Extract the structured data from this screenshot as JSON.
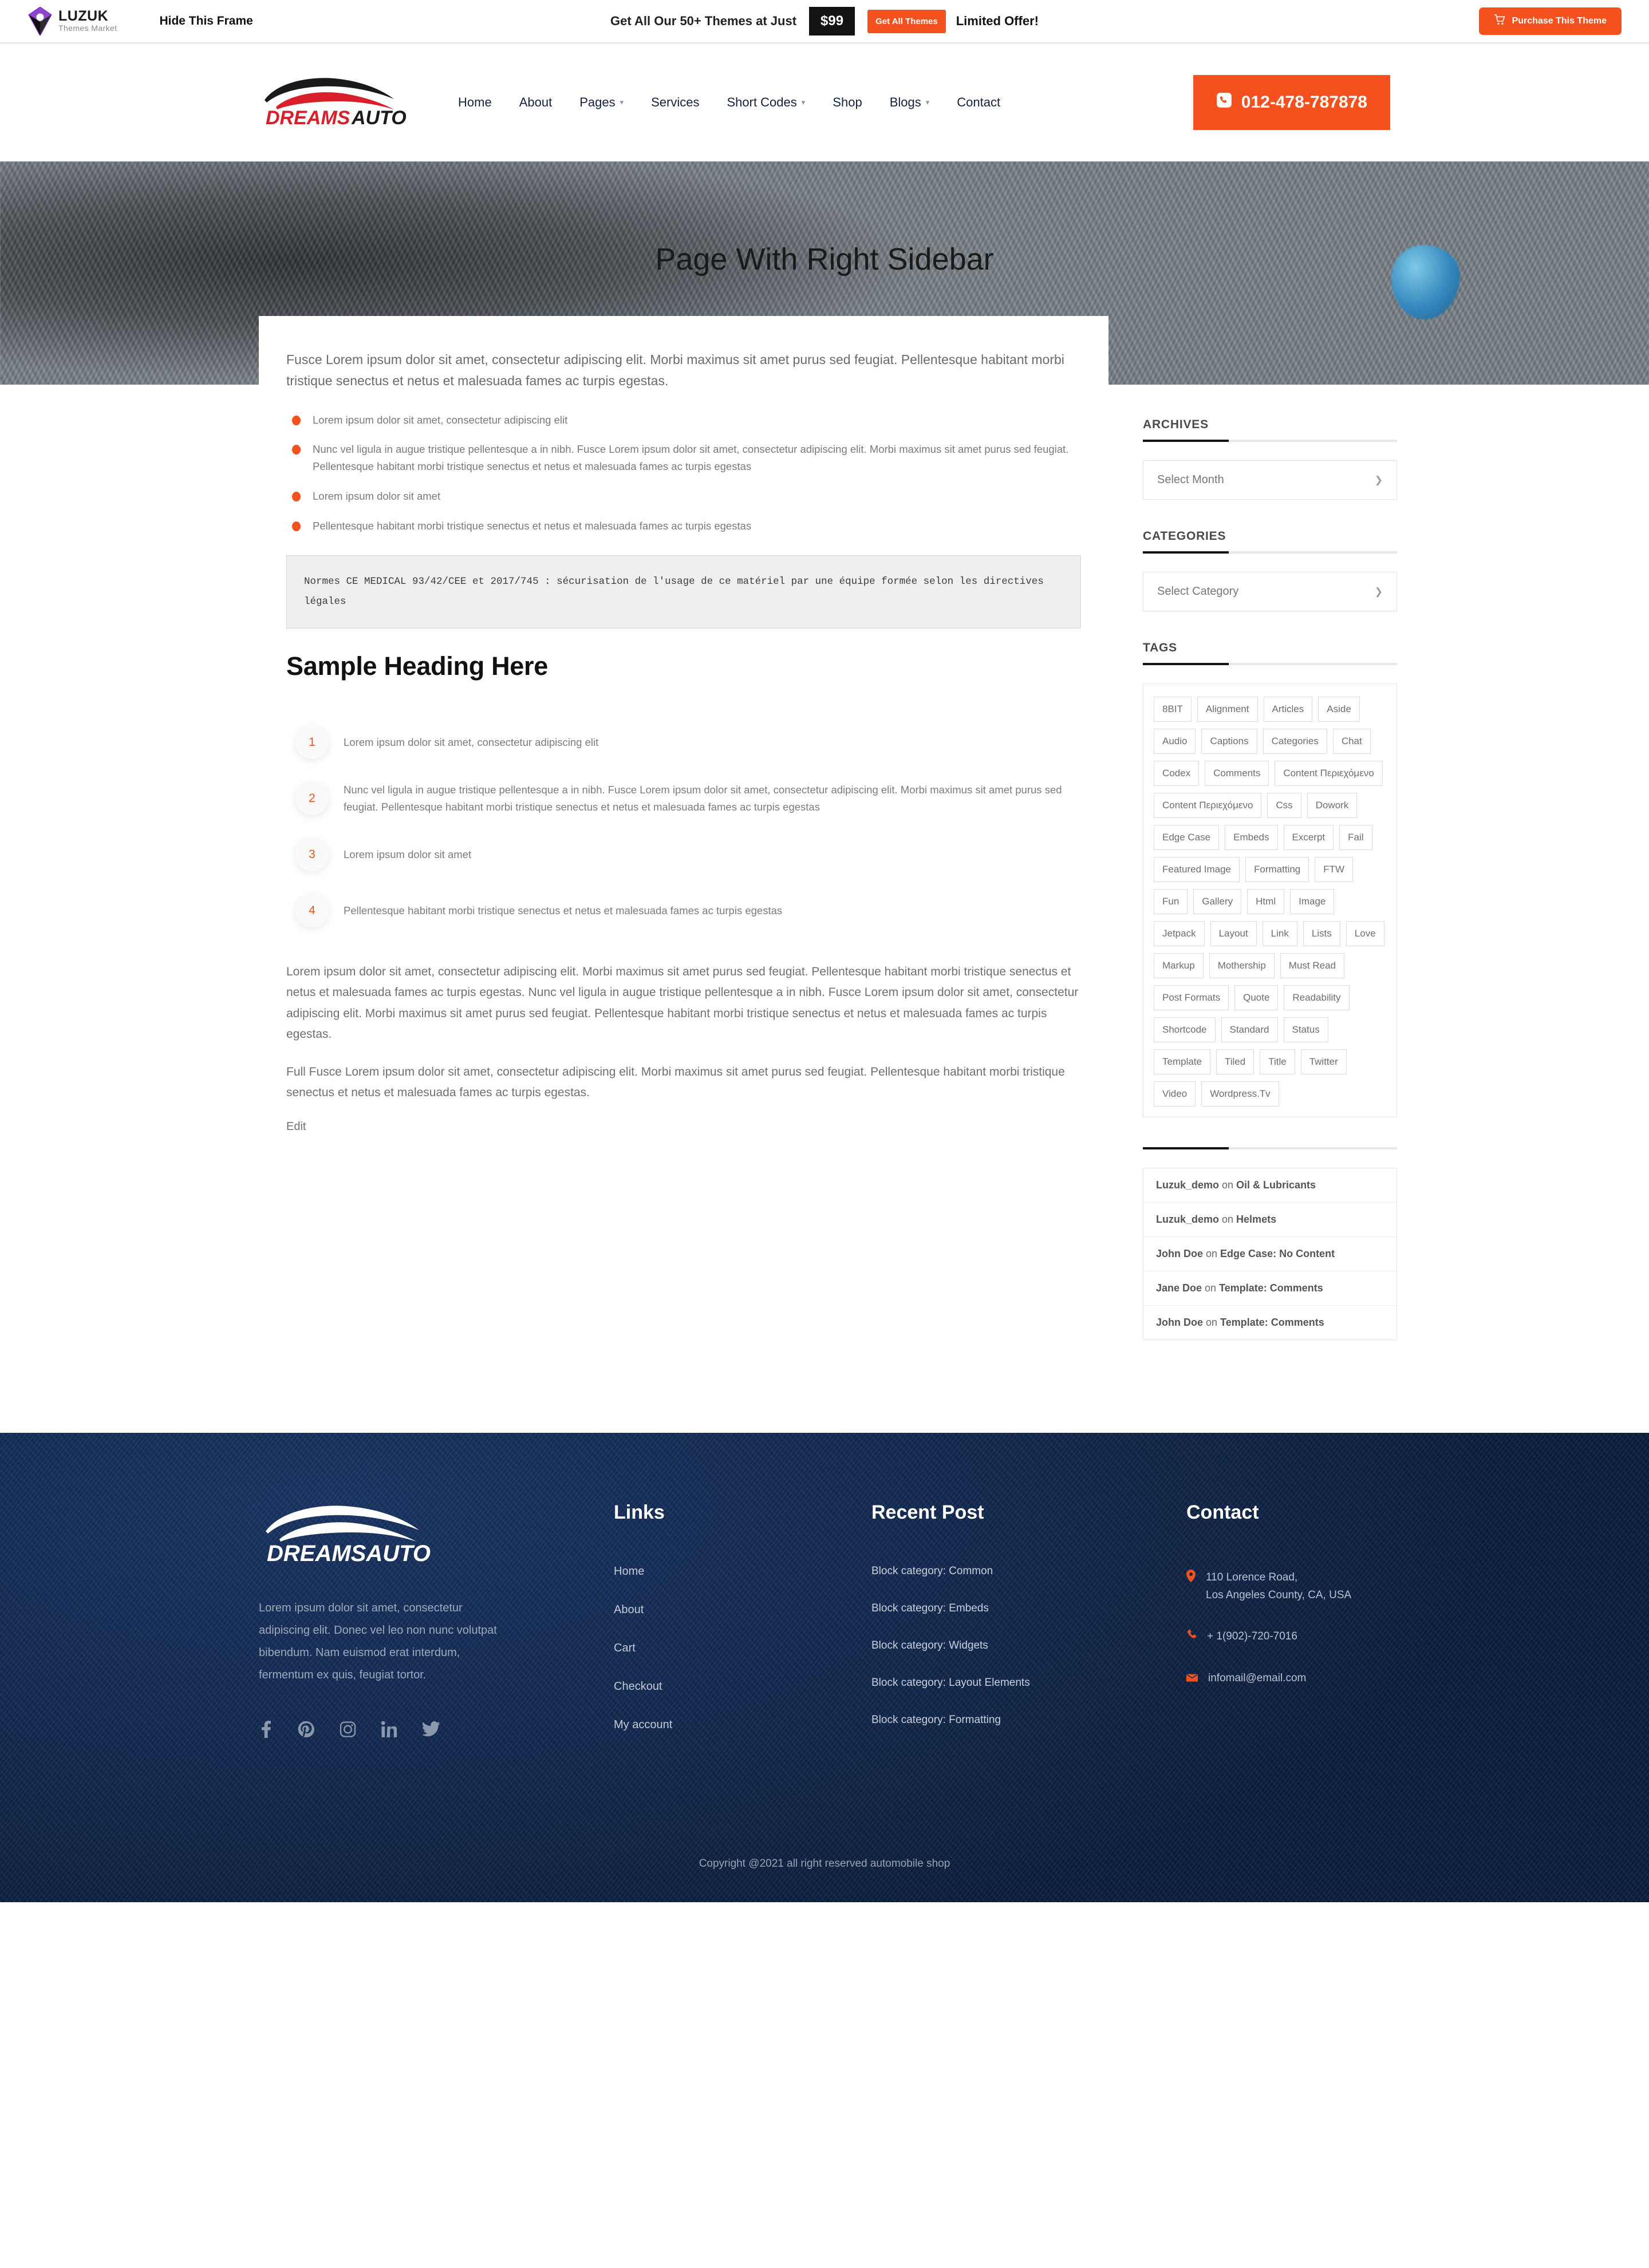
{
  "promo": {
    "brand_name": "LUZUK",
    "brand_sub": "Themes Market",
    "hide_frame": "Hide This Frame",
    "offer_text": "Get All Our 50+ Themes at Just",
    "price": "$99",
    "cta_label": "Get All Themes",
    "limited": "Limited Offer!",
    "purchase_label": "Purchase This Theme",
    "accent": "#f4511e"
  },
  "nav": {
    "logo_main": "DREAMS",
    "logo_accent": "AUTO",
    "items": [
      {
        "label": "Home",
        "has_caret": false
      },
      {
        "label": "About",
        "has_caret": false
      },
      {
        "label": "Pages",
        "has_caret": true
      },
      {
        "label": "Services",
        "has_caret": false
      },
      {
        "label": "Short Codes",
        "has_caret": true
      },
      {
        "label": "Shop",
        "has_caret": false
      },
      {
        "label": "Blogs",
        "has_caret": true
      },
      {
        "label": "Contact",
        "has_caret": false
      }
    ],
    "phone": "012-478-787878"
  },
  "hero": {
    "title": "Page With Right Sidebar"
  },
  "content": {
    "lead": "Fusce Lorem ipsum dolor sit amet, consectetur adipiscing elit. Morbi maximus sit amet purus sed feugiat. Pellentesque habitant morbi tristique senectus et netus et malesuada fames ac turpis egestas.",
    "bullets": [
      "Lorem ipsum dolor sit amet, consectetur adipiscing elit",
      "Nunc vel ligula in augue tristique pellentesque a in nibh. Fusce Lorem ipsum dolor sit amet, consectetur adipiscing elit. Morbi maximus sit amet purus sed feugiat. Pellentesque habitant morbi tristique senectus et netus et malesuada fames ac turpis egestas",
      "Lorem ipsum dolor sit amet",
      "Pellentesque habitant morbi tristique senectus et netus et malesuada fames ac turpis egestas"
    ],
    "code": "Normes CE MEDICAL 93/42/CEE et 2017/745 : sécurisation de l'usage de ce matériel par une équipe formée selon les directives légales",
    "heading": "Sample Heading Here",
    "numbered": [
      {
        "n": "1",
        "text": "Lorem ipsum dolor sit amet, consectetur adipiscing elit"
      },
      {
        "n": "2",
        "text": "Nunc vel ligula in augue tristique pellentesque a in nibh. Fusce Lorem ipsum dolor sit amet, consectetur adipiscing elit. Morbi maximus sit amet purus sed feugiat. Pellentesque habitant morbi tristique senectus et netus et malesuada fames ac turpis egestas"
      },
      {
        "n": "3",
        "text": "Lorem ipsum dolor sit amet"
      },
      {
        "n": "4",
        "text": "Pellentesque habitant morbi tristique senectus et netus et malesuada fames ac turpis egestas"
      }
    ],
    "para1": "Lorem ipsum dolor sit amet, consectetur adipiscing elit. Morbi maximus sit amet purus sed feugiat. Pellentesque habitant morbi tristique senectus et netus et malesuada fames ac turpis egestas. Nunc vel ligula in augue tristique pellentesque a in nibh. Fusce Lorem ipsum dolor sit amet, consectetur adipiscing elit. Morbi maximus sit amet purus sed feugiat. Pellentesque habitant morbi tristique senectus et netus et malesuada fames ac turpis egestas.",
    "para2": "Full Fusce Lorem ipsum dolor sit amet, consectetur adipiscing elit. Morbi maximus sit amet purus sed feugiat. Pellentesque habitant morbi tristique senectus et netus et malesuada fames ac turpis egestas.",
    "edit": "Edit"
  },
  "sidebar": {
    "archives_title": "ARCHIVES",
    "archives_value": "Select Month",
    "categories_title": "CATEGORIES",
    "categories_value": "Select Category",
    "tags_title": "TAGS",
    "tags": [
      "8BIT",
      "Alignment",
      "Articles",
      "Aside",
      "Audio",
      "Captions",
      "Categories",
      "Chat",
      "Codex",
      "Comments",
      "Content Περιεχόμενο",
      "Content Περιεχόμενο",
      "Css",
      "Dowork",
      "Edge Case",
      "Embeds",
      "Excerpt",
      "Fail",
      "Featured Image",
      "Formatting",
      "FTW",
      "Fun",
      "Gallery",
      "Html",
      "Image",
      "Jetpack",
      "Layout",
      "Link",
      "Lists",
      "Love",
      "Markup",
      "Mothership",
      "Must Read",
      "Post Formats",
      "Quote",
      "Readability",
      "Shortcode",
      "Standard",
      "Status",
      "Template",
      "Tiled",
      "Title",
      "Twitter",
      "Video",
      "Wordpress.Tv"
    ],
    "comments": [
      {
        "author": "Luzuk_demo",
        "on": "on",
        "post": "Oil & Lubricants"
      },
      {
        "author": "Luzuk_demo",
        "on": "on",
        "post": "Helmets"
      },
      {
        "author": "John Doe",
        "on": "on",
        "post": "Edge Case: No Content"
      },
      {
        "author": "Jane Doe",
        "on": "on",
        "post": "Template: Comments"
      },
      {
        "author": "John Doe",
        "on": "on",
        "post": "Template: Comments"
      }
    ]
  },
  "footer": {
    "about_text": "Lorem ipsum dolor sit amet, consectetur adipiscing elit. Donec vel leo non nunc volutpat bibendum. Nam euismod erat interdum, fermentum ex quis, feugiat tortor.",
    "links_title": "Links",
    "links": [
      "Home",
      "About",
      "Cart",
      "Checkout",
      "My account"
    ],
    "recent_title": "Recent Post",
    "recent": [
      "Block category: Common",
      "Block category: Embeds",
      "Block category: Widgets",
      "Block category: Layout Elements",
      "Block category: Formatting"
    ],
    "contact_title": "Contact",
    "address_line1": "110 Lorence Road,",
    "address_line2": "Los Angeles County, CA, USA",
    "phone": "+ 1(902)-720-7016",
    "email": "infomail@email.com",
    "copyright": "Copyright @2021 all right reserved automobile shop",
    "socials": [
      "facebook-icon",
      "pinterest-icon",
      "instagram-icon",
      "linkedin-icon",
      "twitter-icon"
    ]
  }
}
